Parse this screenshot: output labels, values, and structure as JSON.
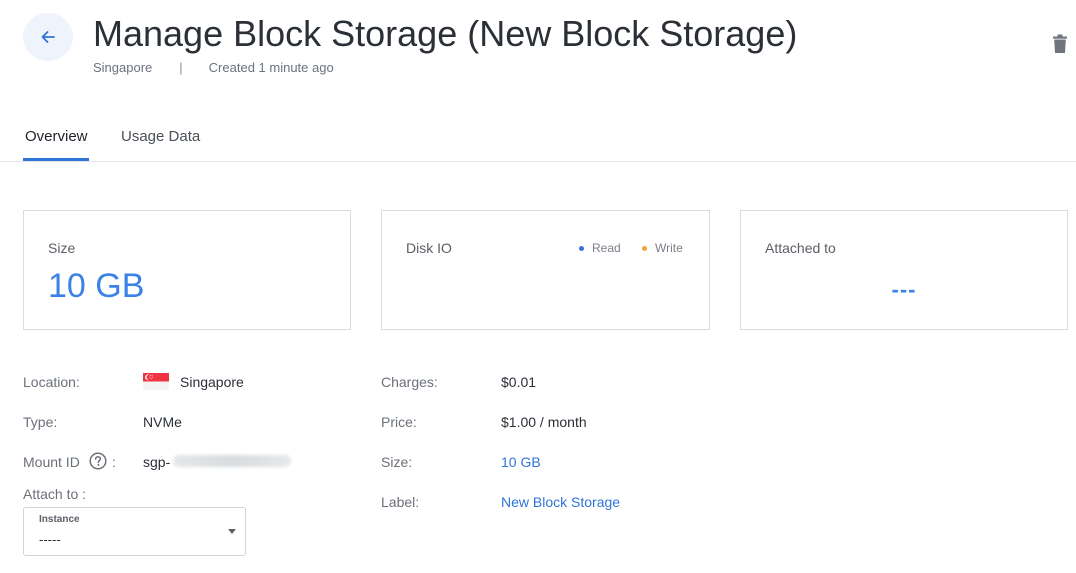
{
  "header": {
    "title": "Manage Block Storage (New Block Storage)",
    "location": "Singapore",
    "separator": "|",
    "created": "Created 1 minute ago",
    "back_icon": "arrow-left-icon",
    "delete_icon": "trash-icon"
  },
  "tabs": [
    {
      "label": "Overview",
      "active": true
    },
    {
      "label": "Usage Data",
      "active": false
    }
  ],
  "cards": {
    "size": {
      "label": "Size",
      "value": "10 GB"
    },
    "disk_io": {
      "label": "Disk IO",
      "legend": [
        {
          "label": "Read",
          "color": "#3b6fe0"
        },
        {
          "label": "Write",
          "color": "#f2a531"
        }
      ]
    },
    "attached": {
      "label": "Attached to",
      "value": "---"
    }
  },
  "details": {
    "location_label": "Location:",
    "location_value": "Singapore",
    "location_flag": "singapore-flag-icon",
    "type_label": "Type:",
    "type_value": "NVMe",
    "mount_id_label": "Mount ID",
    "mount_id_colon": ":",
    "mount_id_prefix": "sgp-",
    "attach_label": "Attach to :",
    "charges_label": "Charges:",
    "charges_value": "$0.01",
    "price_label": "Price:",
    "price_value": "$1.00 / month",
    "size_label": "Size:",
    "size_value": "10 GB",
    "label_label": "Label:",
    "label_value": "New Block Storage"
  },
  "attach_select": {
    "label": "Instance",
    "value": "-----"
  },
  "colors": {
    "accent": "#2f74d8",
    "value_blue": "#3b82e6",
    "read": "#3b6fe0",
    "write": "#f2a531"
  }
}
